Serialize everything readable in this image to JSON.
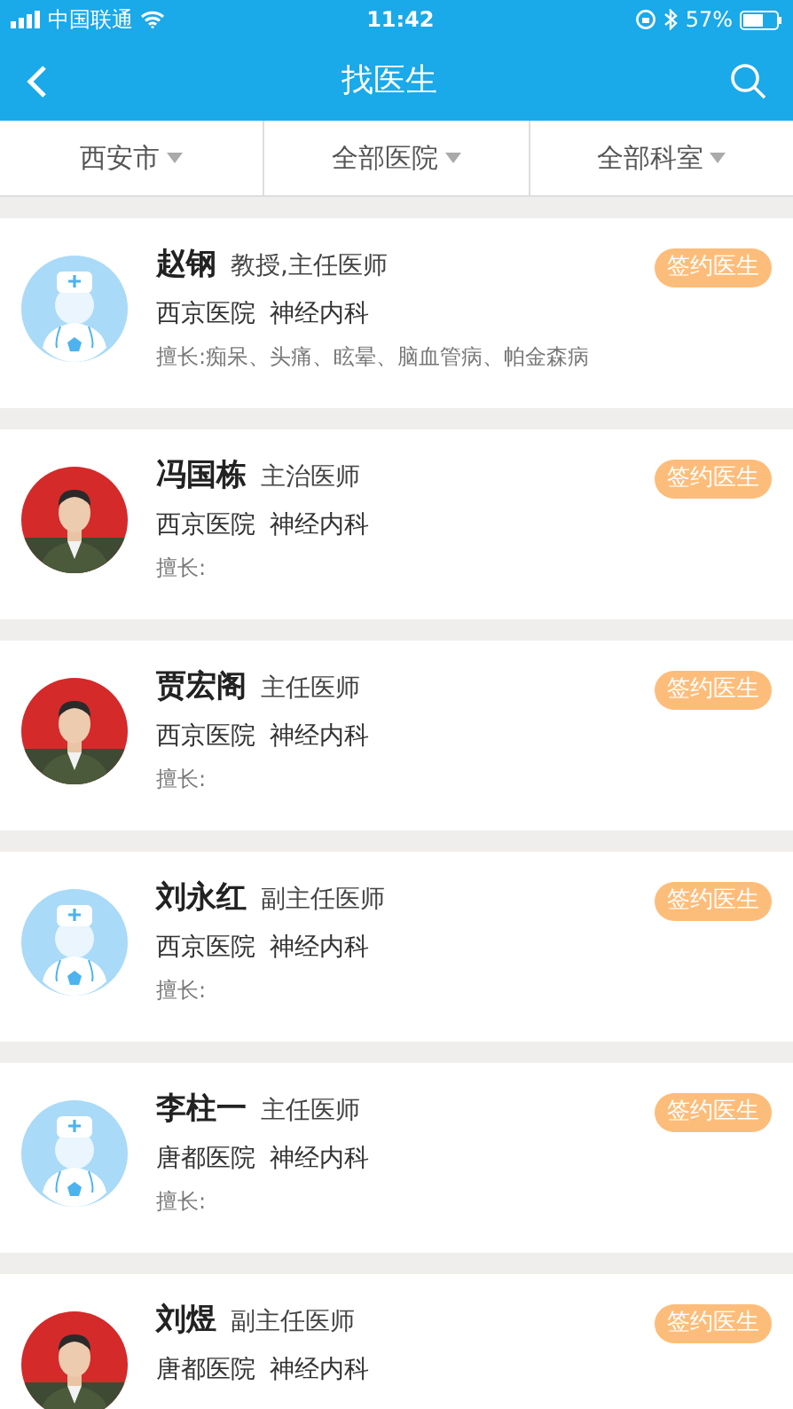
{
  "status_bar": {
    "carrier": "中国联通",
    "time": "11:42",
    "battery": "57%"
  },
  "nav": {
    "title": "找医生"
  },
  "filters": [
    {
      "label": "西安市"
    },
    {
      "label": "全部医院"
    },
    {
      "label": "全部科室"
    }
  ],
  "doctors": [
    {
      "kind": "default",
      "name": "赵钢",
      "title": "教授,主任医师",
      "hospital": "西京医院",
      "department": "神经内科",
      "specialty": "擅长:痴呆、头痛、眩晕、脑血管病、帕金森病",
      "badge": "签约医生"
    },
    {
      "kind": "picture",
      "name": "冯国栋",
      "title": "主治医师",
      "hospital": "西京医院",
      "department": "神经内科",
      "specialty": "擅长:",
      "badge": "签约医生"
    },
    {
      "kind": "picture",
      "name": "贾宏阁",
      "title": "主任医师",
      "hospital": "西京医院",
      "department": "神经内科",
      "specialty": "擅长:",
      "badge": "签约医生"
    },
    {
      "kind": "default",
      "name": "刘永红",
      "title": "副主任医师",
      "hospital": "西京医院",
      "department": "神经内科",
      "specialty": "擅长:",
      "badge": "签约医生"
    },
    {
      "kind": "default",
      "name": "李柱一",
      "title": "主任医师",
      "hospital": "唐都医院",
      "department": "神经内科",
      "specialty": "擅长:",
      "badge": "签约医生"
    },
    {
      "kind": "picture",
      "name": "刘煜",
      "title": "副主任医师",
      "hospital": "唐都医院",
      "department": "神经内科",
      "badge": "签约医生"
    }
  ]
}
